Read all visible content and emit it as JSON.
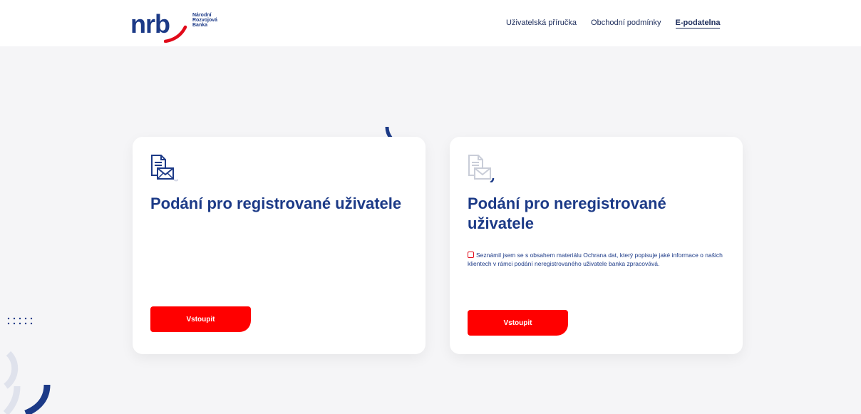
{
  "header": {
    "logo": {
      "word": "nrb",
      "line1": "Národní",
      "line2": "Rozvojová",
      "line3": "Banka"
    },
    "nav": [
      {
        "label": "Uživatelská příručka",
        "active": false
      },
      {
        "label": "Obchodní podmínky",
        "active": false
      },
      {
        "label": "E-podatelna",
        "active": true
      }
    ]
  },
  "cards": {
    "registered": {
      "title": "Podání pro registrované uživatele",
      "button_label": "Vstoupit",
      "icon": "document-envelope-icon"
    },
    "unregistered": {
      "title": "Podání pro neregistrované uživatele",
      "consent_text": "Seznámil jsem se s obsahem materiálu Ochrana dat, který popisuje jaké informace o našich klientech v rámci podání neregistrovaného uživatele banka zpracovává.",
      "consent_checked": false,
      "button_label": "Vstoupit",
      "icon": "document-envelope-icon"
    }
  },
  "colors": {
    "brand_blue": "#1c3a87",
    "brand_red": "#ff0000",
    "background": "#f5f5f7"
  }
}
